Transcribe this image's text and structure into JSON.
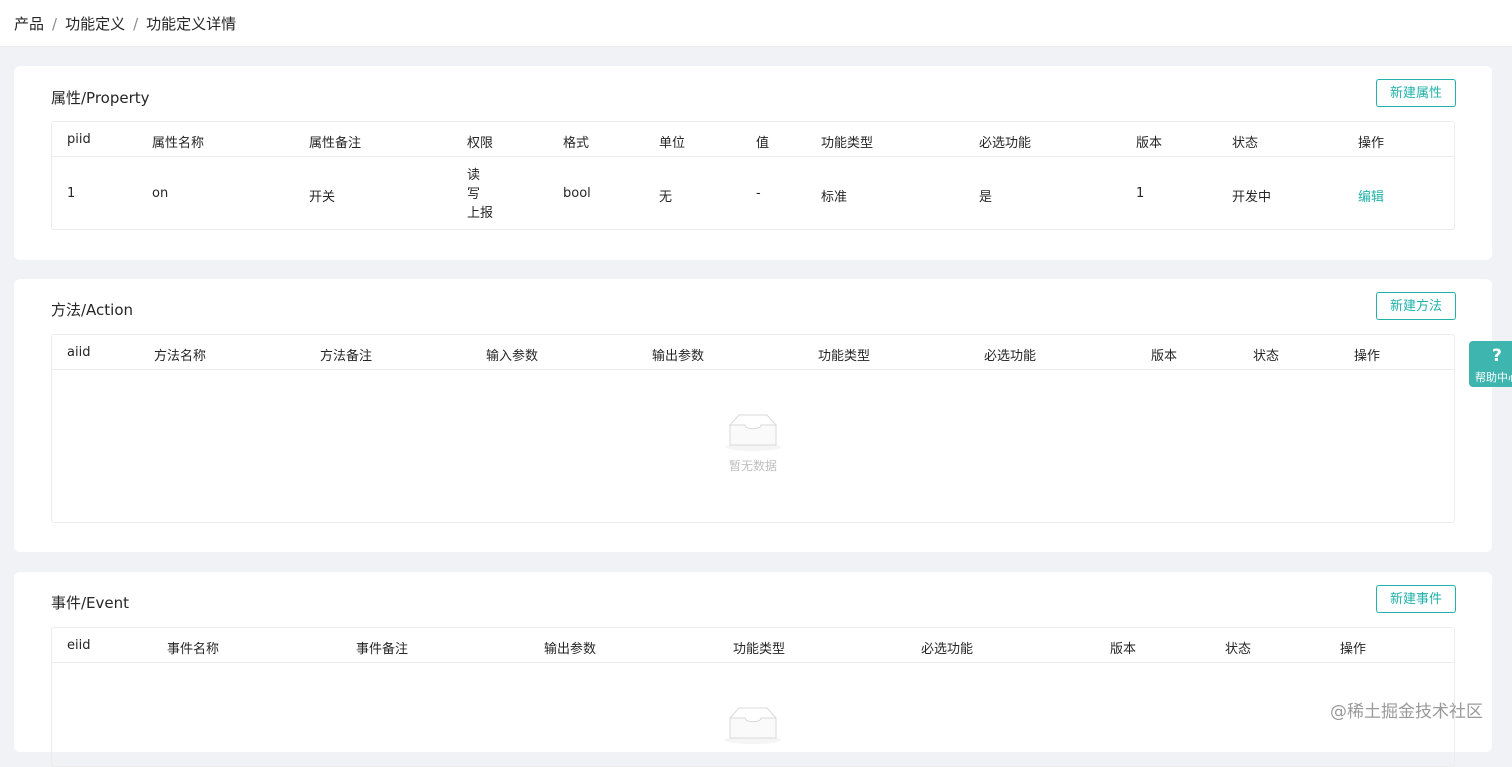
{
  "breadcrumb": [
    "产品",
    "功能定义",
    "功能定义详情"
  ],
  "breadcrumb_separator": "/",
  "property": {
    "title": "属性/Property",
    "add_label": "新建属性",
    "columns": [
      "piid",
      "属性名称",
      "属性备注",
      "权限",
      "格式",
      "单位",
      "值",
      "功能类型",
      "必选功能",
      "版本",
      "状态",
      "操作"
    ],
    "rows": [
      {
        "piid": "1",
        "name": "on",
        "remark": "开关",
        "permissions": [
          "读",
          "写",
          "上报"
        ],
        "format": "bool",
        "unit": "无",
        "value": "-",
        "func_type": "标准",
        "required": "是",
        "version": "1",
        "status": "开发中",
        "action": "编辑"
      }
    ]
  },
  "action": {
    "title": "方法/Action",
    "add_label": "新建方法",
    "columns": [
      "aiid",
      "方法名称",
      "方法备注",
      "输入参数",
      "输出参数",
      "功能类型",
      "必选功能",
      "版本",
      "状态",
      "操作"
    ],
    "empty_text": "暂无数据"
  },
  "event": {
    "title": "事件/Event",
    "add_label": "新建事件",
    "columns": [
      "eiid",
      "事件名称",
      "事件备注",
      "输出参数",
      "功能类型",
      "必选功能",
      "版本",
      "状态",
      "操作"
    ]
  },
  "help": {
    "icon": "?",
    "label": "帮助中心"
  },
  "watermark": "@稀土掘金技术社区",
  "colors": {
    "accent": "#20b2aa",
    "help_bg": "#3fb5b0",
    "page_bg": "#f0f2f5"
  }
}
